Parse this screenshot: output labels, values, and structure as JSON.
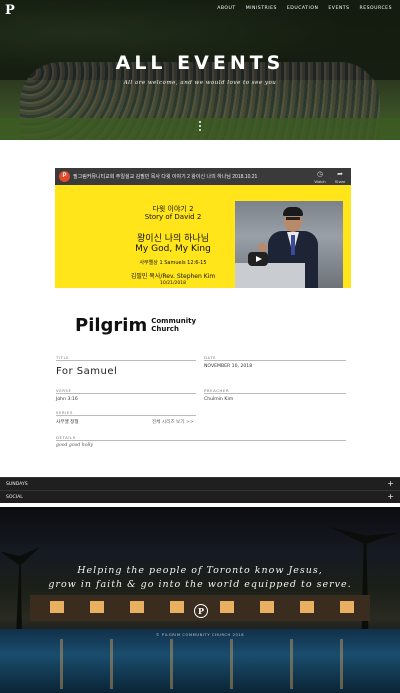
{
  "header": {
    "logo": "P",
    "nav": [
      "ABOUT",
      "MINISTRIES",
      "EDUCATION",
      "EVENTS",
      "RESOURCES"
    ],
    "title": "ALL EVENTS",
    "subtitle": "All are welcome, and we would love to see you"
  },
  "video": {
    "channel_initial": "P",
    "title": "필그림커뮤니티교회 주일설교 김필민 목사 다윗 이야기 2 왕이신 나의 하나님 2018.10.21",
    "watch_later": "Watch later",
    "share": "Share",
    "slide": {
      "series_kr": "다윗 이야기 2",
      "series_en": "Story of David 2",
      "title_kr": "왕이신 나의 하나님",
      "title_en": "My God, My King",
      "verse": "사무엘상 1 Samuels 12:6-15",
      "speaker": "김필민 목사/Rev. Stephen Kim",
      "date": "10/21/2018"
    },
    "brand_name": "Pilgrim",
    "brand_community": "Community",
    "brand_church": "Church"
  },
  "sermon": {
    "title_label": "TITLE",
    "title": "For Samuel",
    "date_label": "DATE",
    "date": "NOVEMBER 10, 2018",
    "verse_label": "VERSE",
    "verse": "John 3:16",
    "preacher_label": "PREACHER",
    "preacher": "Chulmin Kim",
    "series_label": "SERIES",
    "series": "사무엘 정형",
    "series_link": "전체 시리즈 보기 >>",
    "details_label": "DETAILS",
    "details": "good good holly"
  },
  "accordions": [
    {
      "label": "SUNDAYS",
      "icon": "+"
    },
    {
      "label": "SOCIAL",
      "icon": "+"
    }
  ],
  "footer": {
    "line1": "Helping the people of Toronto know Jesus,",
    "line2": "grow in faith & go into the world equipped to serve.",
    "logo": "P",
    "copyright": "© PILGRIM COMMUNITY CHURCH 2018"
  }
}
